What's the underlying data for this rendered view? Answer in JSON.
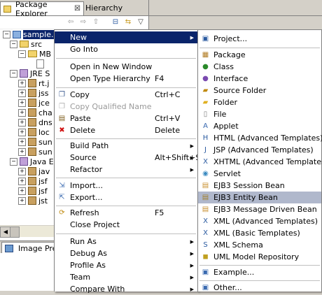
{
  "left_view": {
    "tabs": [
      {
        "label": "Package Explorer",
        "close": "☒"
      },
      {
        "label": "Hierarchy"
      }
    ],
    "tree": [
      {
        "label": "sample.ejb",
        "expander": "−",
        "selected": true
      },
      {
        "label": "src",
        "expander": "−"
      },
      {
        "label": "MB",
        "expander": "−"
      },
      {
        "label": "",
        "expander": ""
      },
      {
        "label": "JRE S",
        "expander": "−"
      },
      {
        "label": "rt.j",
        "expander": "+"
      },
      {
        "label": "jss",
        "expander": "+"
      },
      {
        "label": "jce",
        "expander": "+"
      },
      {
        "label": "cha",
        "expander": "+"
      },
      {
        "label": "dns",
        "expander": "+"
      },
      {
        "label": "loc",
        "expander": "+"
      },
      {
        "label": "sun",
        "expander": "+"
      },
      {
        "label": "sun",
        "expander": "+"
      },
      {
        "label": "Java E",
        "expander": "−"
      },
      {
        "label": "jav",
        "expander": "+"
      },
      {
        "label": "jsf",
        "expander": "+"
      },
      {
        "label": "jsf",
        "expander": "+"
      },
      {
        "label": "jst",
        "expander": "+"
      }
    ],
    "image_preview_tab": "Image Preview"
  },
  "context_menu": {
    "items": [
      {
        "label": "New",
        "arrow": "▶"
      },
      {
        "label": "Go Into"
      },
      {
        "label": "Open in New Window"
      },
      {
        "label": "Open Type Hierarchy",
        "shortcut": "F4"
      },
      {
        "label": "Copy",
        "shortcut": "Ctrl+C"
      },
      {
        "label": "Copy Qualified Name"
      },
      {
        "label": "Paste",
        "shortcut": "Ctrl+V"
      },
      {
        "label": "Delete",
        "shortcut": "Delete"
      },
      {
        "label": "Build Path",
        "arrow": "▶"
      },
      {
        "label": "Source",
        "shortcut": "Alt+Shift+S",
        "arrow": "▶"
      },
      {
        "label": "Refactor",
        "arrow": "▶"
      },
      {
        "label": "Import..."
      },
      {
        "label": "Export..."
      },
      {
        "label": "Refresh",
        "shortcut": "F5"
      },
      {
        "label": "Close Project"
      },
      {
        "label": "Run As",
        "arrow": "▶"
      },
      {
        "label": "Debug As",
        "arrow": "▶"
      },
      {
        "label": "Profile As",
        "arrow": "▶"
      },
      {
        "label": "Team",
        "arrow": "▶"
      },
      {
        "label": "Compare With",
        "arrow": "▶"
      }
    ]
  },
  "new_submenu": {
    "items": [
      {
        "label": "Project...",
        "icon": "project-icon"
      },
      {
        "label": "Package",
        "icon": "package-icon"
      },
      {
        "label": "Class",
        "icon": "class-icon"
      },
      {
        "label": "Interface",
        "icon": "interface-icon"
      },
      {
        "label": "Source Folder",
        "icon": "source-folder-icon"
      },
      {
        "label": "Folder",
        "icon": "folder-icon"
      },
      {
        "label": "File",
        "icon": "file-icon"
      },
      {
        "label": "Applet",
        "icon": "applet-icon"
      },
      {
        "label": "HTML (Advanced Templates)",
        "icon": "html-icon"
      },
      {
        "label": "JSP (Advanced Templates)",
        "icon": "jsp-icon"
      },
      {
        "label": "XHTML (Advanced Templates)",
        "icon": "xhtml-icon"
      },
      {
        "label": "Servlet",
        "icon": "servlet-icon"
      },
      {
        "label": "EJB3 Session Bean",
        "icon": "session-bean-icon"
      },
      {
        "label": "EJB3 Entity Bean",
        "icon": "entity-bean-icon"
      },
      {
        "label": "EJB3 Message Driven Bean",
        "icon": "message-bean-icon"
      },
      {
        "label": "XML (Advanced Templates)",
        "icon": "xml-icon"
      },
      {
        "label": "XML (Basic Templates)",
        "icon": "xml-icon"
      },
      {
        "label": "XML Schema",
        "icon": "xml-schema-icon"
      },
      {
        "label": "UML Model Repository",
        "icon": "uml-icon"
      },
      {
        "label": "Example...",
        "icon": "example-icon"
      },
      {
        "label": "Other...",
        "icon": "other-icon"
      }
    ]
  },
  "colors": {
    "selection": "#0a246a",
    "submenu_highlight": "#b0b8cc"
  }
}
